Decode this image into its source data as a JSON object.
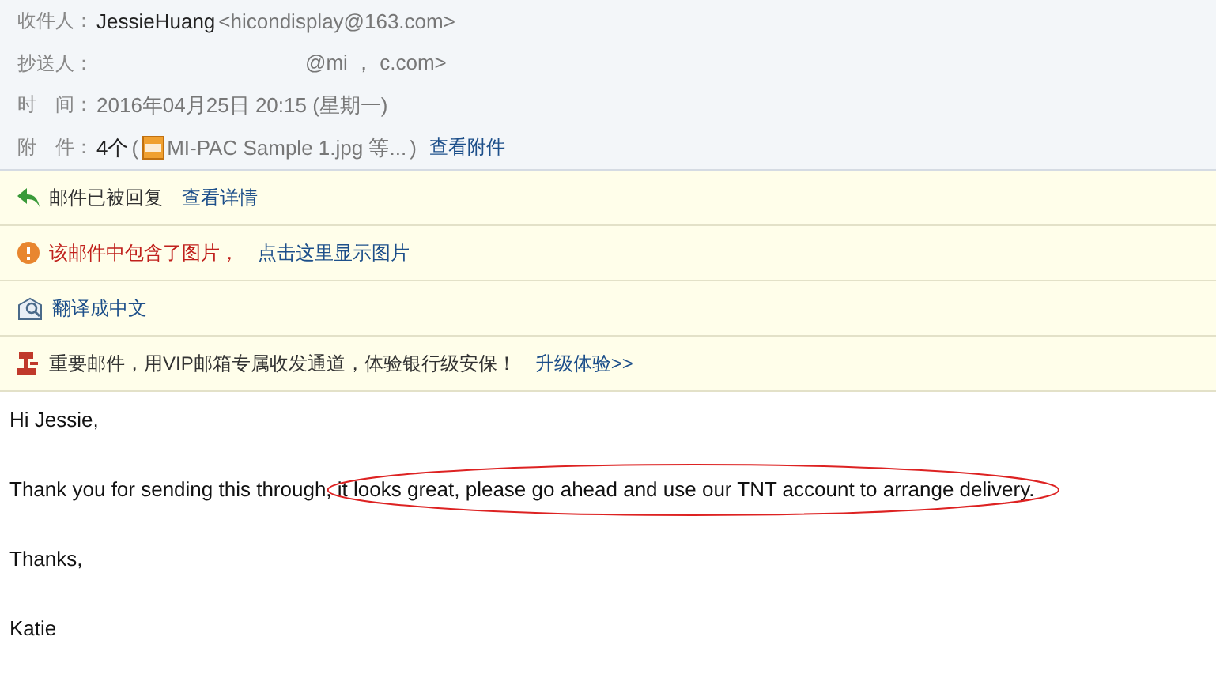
{
  "header": [
    {
      "kind": "to",
      "label": "收件人：",
      "name": "JessieHuang",
      "address": "<hicondisplay@163.com>"
    },
    {
      "kind": "cc",
      "label": "抄送人：",
      "address": "@mi ，  c.com>"
    },
    {
      "kind": "time",
      "label": "时　间：",
      "value": "2016年04月25日 20:15 (星期一)"
    },
    {
      "kind": "attach",
      "label": "附　件：",
      "count": "4个",
      "open": "(",
      "file": "MI-PAC Sample 1.jpg 等...",
      "close": ")",
      "link": "查看附件"
    }
  ],
  "notices": [
    {
      "kind": "replied",
      "text": "邮件已被回复",
      "link": "查看详情"
    },
    {
      "kind": "warning",
      "text": "该邮件中包含了图片，",
      "link": "点击这里显示图片"
    },
    {
      "kind": "translate",
      "link": "翻译成中文"
    },
    {
      "kind": "vip",
      "text": "重要邮件，用VIP邮箱专属收发通道，体验银行级安保！",
      "link": "升级体验>>"
    }
  ],
  "body": [
    {
      "text": "Hi Jessie,"
    },
    {
      "text": "Thank you for sending this through,",
      "circled": "it looks great, please go ahead and use our TNT account to arrange delivery."
    },
    {
      "text": "Thanks,"
    },
    {
      "text": "Katie"
    }
  ]
}
